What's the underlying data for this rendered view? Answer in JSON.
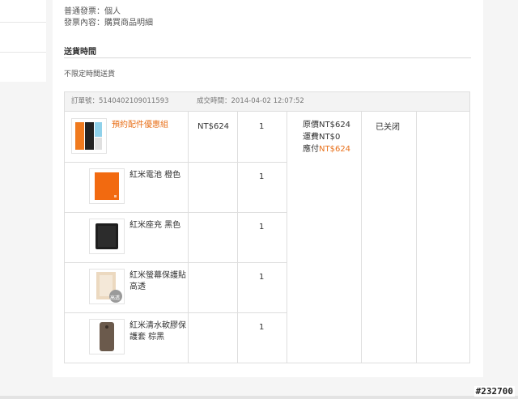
{
  "invoice": {
    "type_line": "普通發票：個人",
    "content_line": "發票內容：購買商品明細"
  },
  "delivery": {
    "title": "送貨時間",
    "value": "不限定時間送貨"
  },
  "order": {
    "number_label": "訂單號：5140402109011593",
    "time_label": "成交時間：2014-04-02 12:07:52",
    "bundle": {
      "name": "預約配件優惠組",
      "price": "NT$624",
      "qty": "1"
    },
    "items": [
      {
        "name": "紅米電池 橙色",
        "qty": "1",
        "icon": "orange-battery-icon"
      },
      {
        "name": "紅米座充 黑色",
        "qty": "1",
        "icon": "black-charger-icon"
      },
      {
        "name": "紅米螢幕保護貼 高透",
        "qty": "1",
        "icon": "screen-protector-icon",
        "badge": "高透"
      },
      {
        "name": "紅米清水軟膠保護套 棕黑",
        "qty": "1",
        "icon": "brown-case-icon"
      }
    ],
    "summary": {
      "original": "原價NT$624",
      "shipping": "運費NT$0",
      "payable_label": "應付",
      "payable_value": "NT$624"
    },
    "status": "已关闭"
  },
  "watermark": "#232700",
  "colors": {
    "accent": "#e8701a",
    "border": "#dedede",
    "header_bg": "#f3f3f3"
  }
}
